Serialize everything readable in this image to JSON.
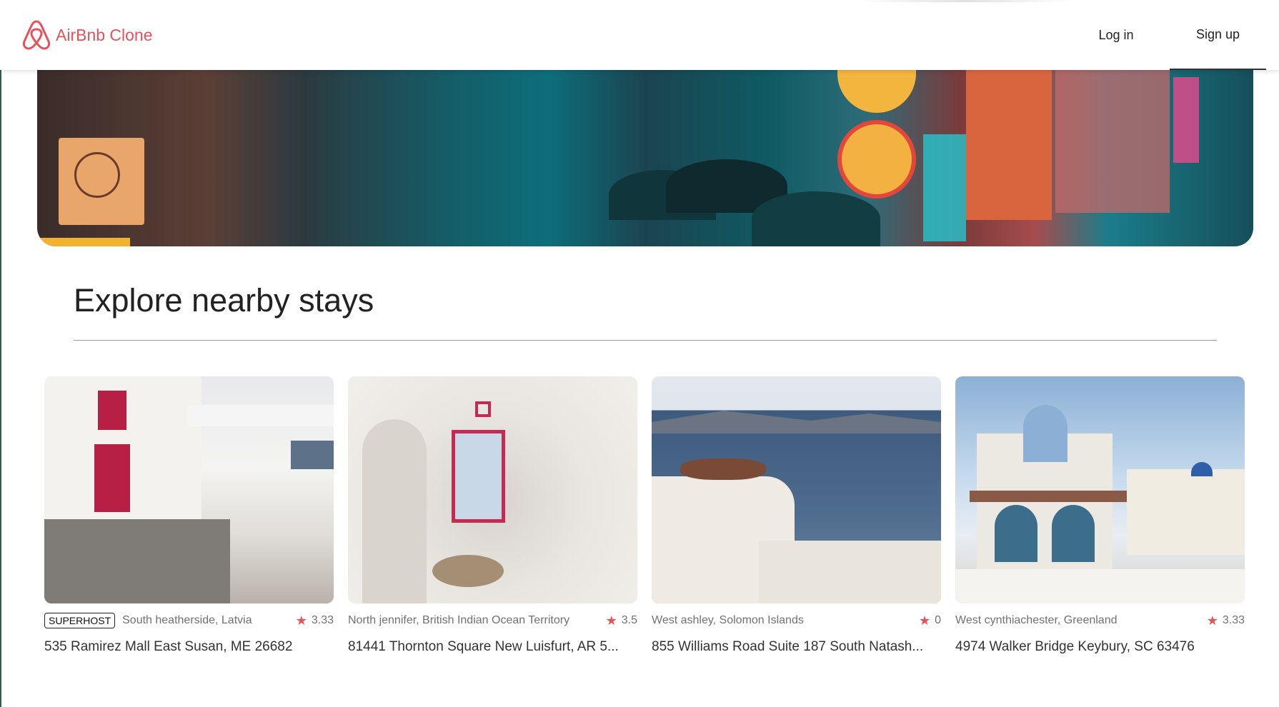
{
  "app": {
    "brand_name": "AirBnb Clone",
    "brand_color": "#e8515b"
  },
  "nav": {
    "login_label": "Log in",
    "signup_label": "Sign up"
  },
  "section": {
    "title": "Explore nearby stays"
  },
  "listings": [
    {
      "badge": "SUPERHOST",
      "location": "South heatherside, Latvia",
      "rating": "3.33",
      "address": "535 Ramirez Mall East Susan, ME 26682"
    },
    {
      "badge": "",
      "location": "North jennifer, British Indian Ocean Territory",
      "rating": "3.5",
      "address": "81441 Thornton Square New Luisfurt, AR 5..."
    },
    {
      "badge": "",
      "location": "West ashley, Solomon Islands",
      "rating": "0",
      "address": "855 Williams Road Suite 187 South Natash..."
    },
    {
      "badge": "",
      "location": "West cynthiachester, Greenland",
      "rating": "3.33",
      "address": "4974 Walker Bridge Keybury, SC 63476"
    }
  ],
  "icons": {
    "logo": "airbnb-logo-icon",
    "rating": "star-icon"
  }
}
